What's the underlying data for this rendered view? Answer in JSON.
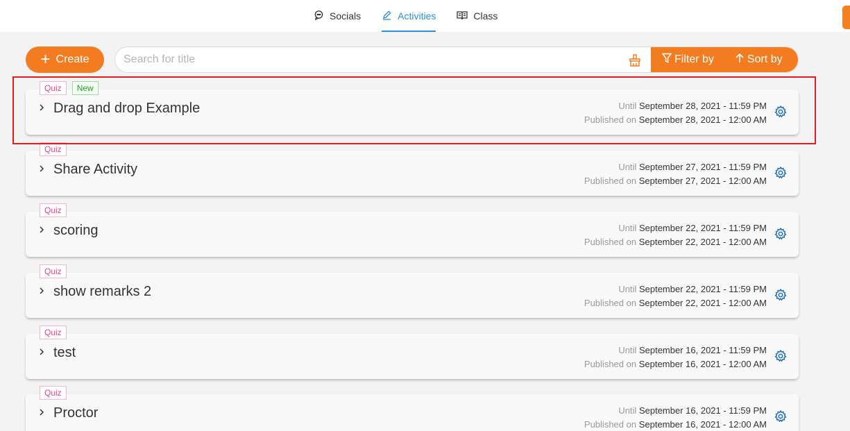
{
  "nav": {
    "tabs": [
      {
        "label": "Socials",
        "icon": "chat-icon"
      },
      {
        "label": "Activities",
        "icon": "pencil-icon",
        "active": true
      },
      {
        "label": "Class",
        "icon": "book-icon"
      }
    ]
  },
  "toolbar": {
    "create_label": "Create",
    "search_placeholder": "Search for title",
    "search_value": "",
    "filter_label": "Filter by",
    "sort_label": "Sort by"
  },
  "colors": {
    "accent": "#f47c20",
    "active_tab": "#2b8fd6",
    "quiz_badge": "#e0468a",
    "new_badge": "#2a9c2a",
    "gear": "#1f6fb8",
    "highlight": "#e21b1b"
  },
  "activities": [
    {
      "title": "Drag and drop Example",
      "badges": [
        "Quiz",
        "New"
      ],
      "until_label": "Until",
      "until": "September 28, 2021 - 11:59 PM",
      "published_label": "Published on",
      "published": "September 28, 2021 - 12:00 AM"
    },
    {
      "title": "Share Activity",
      "badges": [
        "Quiz"
      ],
      "until_label": "Until",
      "until": "September 27, 2021 - 11:59 PM",
      "published_label": "Published on",
      "published": "September 27, 2021 - 12:00 AM"
    },
    {
      "title": "scoring",
      "badges": [
        "Quiz"
      ],
      "until_label": "Until",
      "until": "September 22, 2021 - 11:59 PM",
      "published_label": "Published on",
      "published": "September 22, 2021 - 12:00 AM"
    },
    {
      "title": "show remarks 2",
      "badges": [
        "Quiz"
      ],
      "until_label": "Until",
      "until": "September 22, 2021 - 11:59 PM",
      "published_label": "Published on",
      "published": "September 22, 2021 - 12:00 AM"
    },
    {
      "title": "test",
      "badges": [
        "Quiz"
      ],
      "until_label": "Until",
      "until": "September 16, 2021 - 11:59 PM",
      "published_label": "Published on",
      "published": "September 16, 2021 - 12:00 AM"
    },
    {
      "title": "Proctor",
      "badges": [
        "Quiz"
      ],
      "until_label": "Until",
      "until": "September 16, 2021 - 11:59 PM",
      "published_label": "Published on",
      "published": "September 16, 2021 - 12:00 AM"
    }
  ]
}
